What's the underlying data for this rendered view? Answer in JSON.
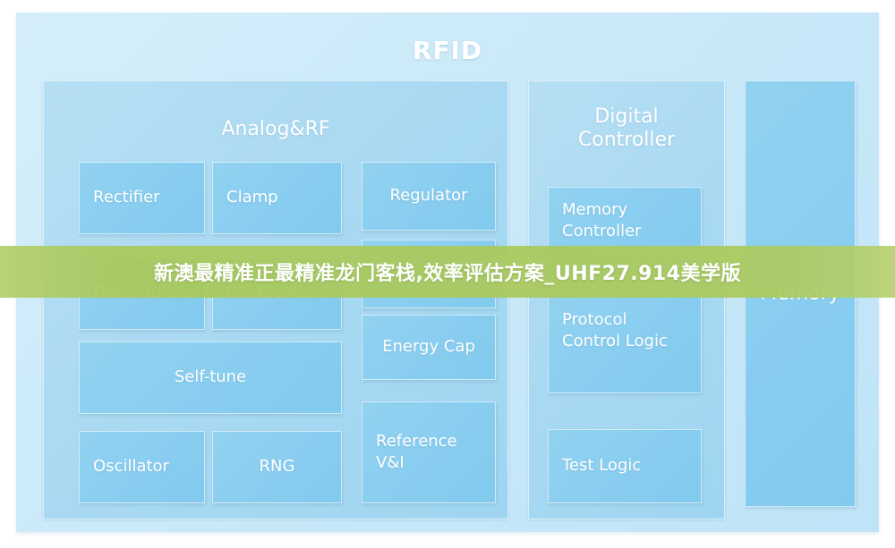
{
  "diagram": {
    "title": "RFID",
    "sections": {
      "analog": {
        "title": "Analog&RF"
      },
      "digital": {
        "title": "Digital\nController"
      }
    },
    "modules": {
      "rectifier": "Rectifier",
      "clamp": "Clamp",
      "regulator": "Regulator",
      "demodulator": "Demodulator",
      "backscatter": "Backscatter",
      "self_tune": "Self-tune",
      "oscillator": "Oscillator",
      "rng": "RNG",
      "energy_cap": "Energy Cap",
      "reference": "Reference\nV&I",
      "occluded": "",
      "memory_controller": "Memory\nController",
      "protocol_control_logic": "Protocol\nControl Logic",
      "test_logic": "Test Logic",
      "memory": "Memory"
    }
  },
  "banner": {
    "text": "新澳最精准正最精准龙门客栈,效率评估方案_UHF27.914美学版"
  },
  "colors": {
    "page_background": "#ffffff",
    "chip_fill": "#cbeaf9",
    "section_fill": "#a9d9f2",
    "module_fill": "#8acef0",
    "label_text": "#ffffff",
    "banner_fill": "#a9c95c",
    "banner_text": "#ffffff"
  }
}
